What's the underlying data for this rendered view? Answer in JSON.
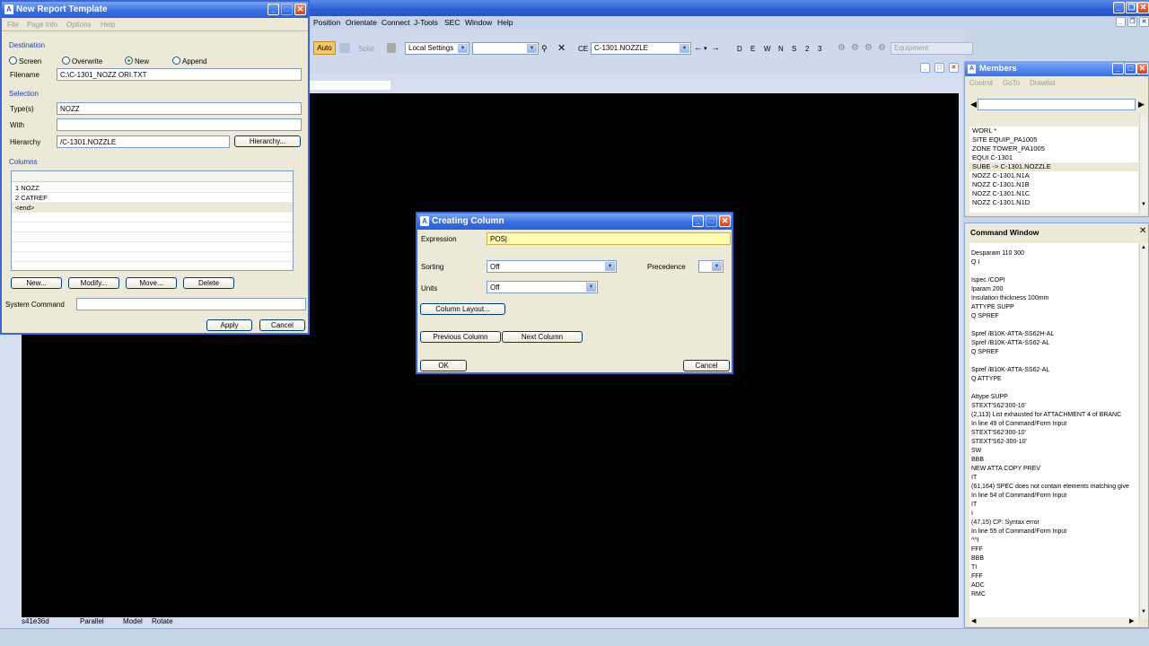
{
  "main_window": {
    "menu": [
      "Position",
      "Orientate",
      "Connect",
      "J-Tools",
      "SEC",
      "Window",
      "Help"
    ],
    "toolbar": {
      "auto_label": "Auto",
      "solid_label": "Solid",
      "settings_value": "Local Settings",
      "ce_label": "CE",
      "ce_value": "C-1301.NOZZLE",
      "directions": [
        "D",
        "E",
        "W",
        "N",
        "S",
        "2",
        "3"
      ],
      "equipment_label": "Equipment"
    },
    "status": [
      "s41e36d",
      "Parallel",
      "Model",
      "Rotate"
    ]
  },
  "report_dialog": {
    "title": "New Report Template",
    "menu": [
      "File",
      "Page Info",
      "Options",
      "Help"
    ],
    "destination_label": "Destination",
    "radios": [
      "Screen",
      "Overwrite",
      "New",
      "Append"
    ],
    "selected_radio": "New",
    "filename_label": "Filename",
    "filename_value": "C:\\C-1301_NOZZ ORI.TXT",
    "selection_label": "Selection",
    "types_label": "Type(s)",
    "types_value": "NOZZ",
    "with_label": "With",
    "with_value": "",
    "hierarchy_label": "Hierarchy",
    "hierarchy_value": "/C-1301.NOZZLE",
    "hierarchy_button": "Hierarchy...",
    "columns_label": "Columns",
    "columns": [
      "1 NOZZ",
      "2 CATREF",
      "<end>"
    ],
    "buttons": [
      "New...",
      "Modify...",
      "Move...",
      "Delete"
    ],
    "system_command_label": "System Command",
    "system_command_value": "",
    "apply_label": "Apply",
    "cancel_label": "Cancel"
  },
  "column_dialog": {
    "title": "Creating Column",
    "expression_label": "Expression",
    "expression_value": "POS",
    "sorting_label": "Sorting",
    "sorting_value": "Off",
    "precedence_label": "Precedence",
    "precedence_value": "",
    "units_label": "Units",
    "units_value": "Off",
    "column_layout_button": "Column Layout...",
    "previous_button": "Previous Column",
    "next_button": "Next Column",
    "ok_label": "OK",
    "cancel_label": "Cancel"
  },
  "members": {
    "title": "Members",
    "menu": [
      "Control",
      "GoTo",
      "Drawlist"
    ],
    "items": [
      "WORL  *",
      "SITE   EQUIP_PA1005",
      "ZONE   TOWER_PA1005",
      "EQUI   C-1301",
      "SUBE -> C-1301.NOZZLE",
      "NOZZ   C-1301.N1A",
      "NOZZ   C-1301.N1B",
      "NOZZ   C-1301.N1C",
      "NOZZ   C-1301.N1D"
    ],
    "selected_index": 4
  },
  "command_window": {
    "title": "Command Window",
    "lines": [
      "Desparam 110 300",
      "Q I",
      "",
      "Ispec /COPI",
      "Iparam 200",
      "Insulation thickness 100mm",
      "ATTYPE SUPP",
      "Q SPREF",
      "",
      "Spref /B10K-ATTA-SS62H-AL",
      "Spref /B10K-ATTA-SS62-AL",
      "Q SPREF",
      "",
      "Spref /B10K-ATTA-SS62-AL",
      "Q ATTYPE",
      "",
      "Attype SUPP",
      "STEXT'S62'300-10'",
      "(2,113)   List exhausted for ATTACHMENT 4 of BRANC",
      " In line 49 of Command/Form Input",
      "STEXT'S62'300-10'",
      "STEXT'S62-300-10'",
      "SW",
      "BBB",
      "NEW ATTA COPY PREV",
      "IT",
      "(61,164)  SPEC does not contain elements matching give",
      " In line 54 of Command/Form Input",
      "IT",
      "I",
      "(47,15)   CP: Syntax error",
      " In line 55 of Command/Form Input",
      "^^I",
      "FFF",
      "BBB",
      "TI",
      "FFF",
      "ADC",
      "RMC"
    ]
  }
}
